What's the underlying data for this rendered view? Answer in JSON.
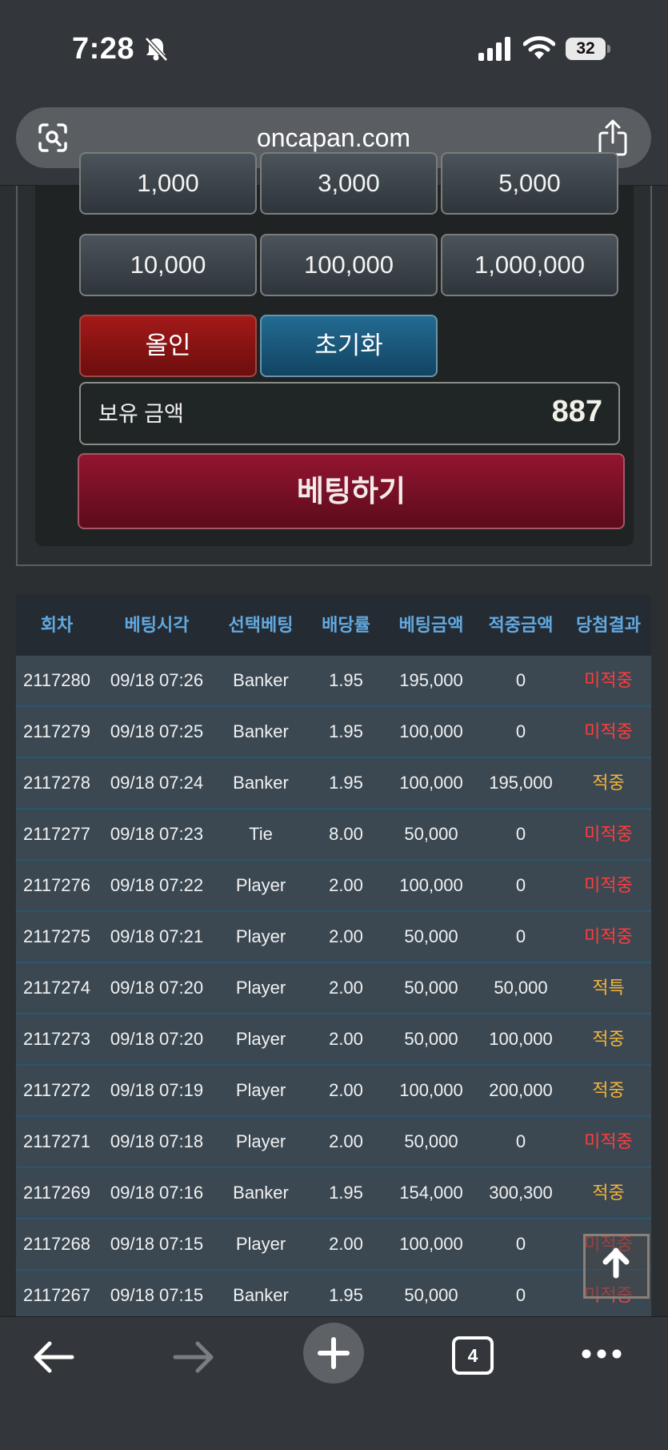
{
  "status_bar": {
    "time": "7:28",
    "battery": "32"
  },
  "browser": {
    "url": "oncapan.com",
    "tab_count": "4"
  },
  "bet_panel": {
    "chips_partial": [
      "1,000",
      "3,000",
      "5,000"
    ],
    "chips": [
      "10,000",
      "100,000",
      "1,000,000"
    ],
    "all_in_label": "올인",
    "reset_label": "초기화",
    "balance_label": "보유 금액",
    "balance_value": "887",
    "bet_label": "베팅하기"
  },
  "history": {
    "headers": [
      "회차",
      "베팅시각",
      "선택베팅",
      "배당률",
      "베팅금액",
      "적중금액",
      "당첨결과"
    ],
    "rows": [
      [
        "2117280",
        "09/18 07:26",
        "Banker",
        "1.95",
        "195,000",
        "0",
        "미적중"
      ],
      [
        "2117279",
        "09/18 07:25",
        "Banker",
        "1.95",
        "100,000",
        "0",
        "미적중"
      ],
      [
        "2117278",
        "09/18 07:24",
        "Banker",
        "1.95",
        "100,000",
        "195,000",
        "적중"
      ],
      [
        "2117277",
        "09/18 07:23",
        "Tie",
        "8.00",
        "50,000",
        "0",
        "미적중"
      ],
      [
        "2117276",
        "09/18 07:22",
        "Player",
        "2.00",
        "100,000",
        "0",
        "미적중"
      ],
      [
        "2117275",
        "09/18 07:21",
        "Player",
        "2.00",
        "50,000",
        "0",
        "미적중"
      ],
      [
        "2117274",
        "09/18 07:20",
        "Player",
        "2.00",
        "50,000",
        "50,000",
        "적특"
      ],
      [
        "2117273",
        "09/18 07:20",
        "Player",
        "2.00",
        "50,000",
        "100,000",
        "적중"
      ],
      [
        "2117272",
        "09/18 07:19",
        "Player",
        "2.00",
        "100,000",
        "200,000",
        "적중"
      ],
      [
        "2117271",
        "09/18 07:18",
        "Player",
        "2.00",
        "50,000",
        "0",
        "미적중"
      ],
      [
        "2117269",
        "09/18 07:16",
        "Banker",
        "1.95",
        "154,000",
        "300,300",
        "적중"
      ],
      [
        "2117268",
        "09/18 07:15",
        "Player",
        "2.00",
        "100,000",
        "0",
        "미적중"
      ],
      [
        "2117267",
        "09/18 07:15",
        "Banker",
        "1.95",
        "50,000",
        "0",
        "미적중"
      ]
    ],
    "colors": {
      "miss": "#ff3c3c",
      "hit": "#f3b43a",
      "header": "#62a9df"
    }
  }
}
